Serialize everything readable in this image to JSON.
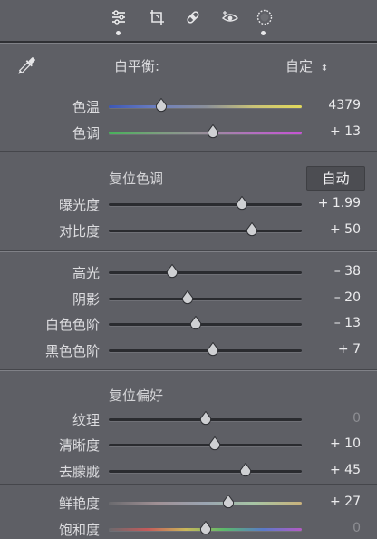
{
  "toolbar": {
    "tools": [
      {
        "name": "basic-adjust-icon",
        "active": true
      },
      {
        "name": "crop-icon",
        "active": false
      },
      {
        "name": "healing-icon",
        "active": false
      },
      {
        "name": "redeye-icon",
        "active": true
      },
      {
        "name": "radial-filter-icon",
        "active": false
      }
    ]
  },
  "white_balance": {
    "label": "白平衡:",
    "value": "自定",
    "arrows": "⬍"
  },
  "temp": {
    "rows": [
      {
        "label": "色温",
        "value": "4379",
        "pct": 0.27,
        "gradient": "temp"
      },
      {
        "label": "色调",
        "value": "+ 13",
        "pct": 0.54,
        "gradient": "tint"
      }
    ]
  },
  "tone": {
    "reset_label": "复位色调",
    "auto_label": "自动",
    "rows": [
      {
        "label": "曝光度",
        "value": "+ 1.99",
        "pct": 0.69
      },
      {
        "label": "对比度",
        "value": "+ 50",
        "pct": 0.74
      }
    ]
  },
  "tone2": {
    "rows": [
      {
        "label": "高光",
        "value": "– 38",
        "pct": 0.33
      },
      {
        "label": "阴影",
        "value": "– 20",
        "pct": 0.41
      },
      {
        "label": "白色色阶",
        "value": "– 13",
        "pct": 0.45
      },
      {
        "label": "黑色色阶",
        "value": "+ 7",
        "pct": 0.54
      }
    ]
  },
  "presence": {
    "reset_label": "复位偏好",
    "rows": [
      {
        "label": "纹理",
        "value": "0",
        "pct": 0.5,
        "dim": true
      },
      {
        "label": "清晰度",
        "value": "+ 10",
        "pct": 0.55
      },
      {
        "label": "去朦胧",
        "value": "+ 45",
        "pct": 0.71
      }
    ]
  },
  "color": {
    "rows": [
      {
        "label": "鲜艳度",
        "value": "+ 27",
        "pct": 0.62,
        "gradient": "vib"
      },
      {
        "label": "饱和度",
        "value": "0",
        "pct": 0.5,
        "gradient": "sat",
        "dim": true
      }
    ]
  }
}
